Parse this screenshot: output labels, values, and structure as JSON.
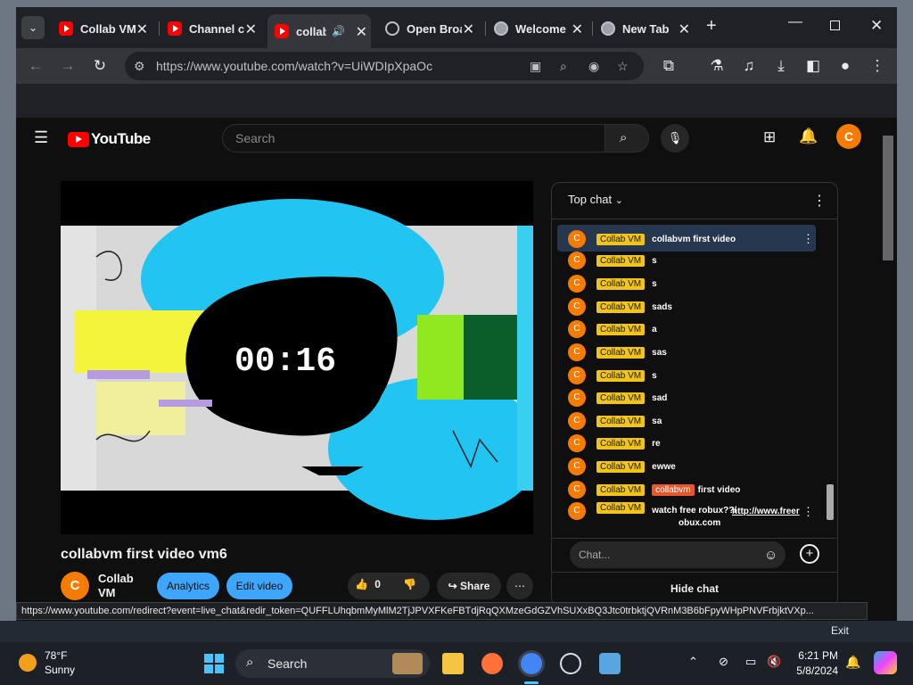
{
  "browser": {
    "tabs": [
      {
        "title": "Collab VM"
      },
      {
        "title": "Channel content"
      },
      {
        "title": "collabvm first video"
      },
      {
        "title": "Open Broadcaster"
      },
      {
        "title": "Welcome"
      },
      {
        "title": "New Tab"
      }
    ],
    "url": "https://www.youtube.com/watch?v=UiWDIpXpaOc"
  },
  "youtube": {
    "logo_text": "YouTube",
    "search_placeholder": "Search",
    "avatar_letter": "C"
  },
  "video": {
    "timer": "00:16",
    "title": "collabvm first video vm6",
    "channel": "Collab VM",
    "channel_letter": "C",
    "analytics_label": "Analytics",
    "edit_label": "Edit video",
    "like_count": "0",
    "share_label": "Share"
  },
  "chat": {
    "mode": "Top chat",
    "messages": [
      {
        "author": "Collab VM",
        "text": "collabvm first video"
      },
      {
        "author": "Collab VM",
        "text": "s"
      },
      {
        "author": "Collab VM",
        "text": "s"
      },
      {
        "author": "Collab VM",
        "text": "sads"
      },
      {
        "author": "Collab VM",
        "text": "a"
      },
      {
        "author": "Collab VM",
        "text": "sas"
      },
      {
        "author": "Collab VM",
        "text": "s"
      },
      {
        "author": "Collab VM",
        "text": "sad"
      },
      {
        "author": "Collab VM",
        "text": "sa"
      },
      {
        "author": "Collab VM",
        "text": "re"
      },
      {
        "author": "Collab VM",
        "text": "ewwe"
      },
      {
        "author": "Collab VM",
        "mention": "collabvm",
        "text": "first video"
      },
      {
        "author": "Collab VM",
        "text": "watch free robux??/ ",
        "link": "http://www.freerobux.com",
        "link_line1": "http://www.freer",
        "link_line2": "obux.com"
      }
    ],
    "input_placeholder": "Chat...",
    "hide_label": "Hide chat"
  },
  "status_url": "https://www.youtube.com/redirect?event=live_chat&redir_token=QUFFLUhqbmMyMlM2TjJPVXFKeFBTdjRqQXMzeGdGZVhSUXxBQ3Jtc0trbktjQVRnM3B6bFpyWHpPNVFrbjktVXp...",
  "background_exit": "Exit",
  "taskbar": {
    "weather_temp": "78°F",
    "weather_desc": "Sunny",
    "search_label": "Search",
    "time": "6:21 PM",
    "date": "5/8/2024"
  }
}
